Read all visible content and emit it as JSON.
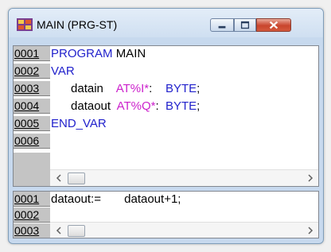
{
  "window": {
    "title": "MAIN (PRG-ST)"
  },
  "declarations": {
    "lines": [
      {
        "num": "0001",
        "tokens": [
          {
            "t": "PROGRAM ",
            "c": "kw"
          },
          {
            "t": "MAIN",
            "c": "tx"
          }
        ]
      },
      {
        "num": "0002",
        "tokens": [
          {
            "t": "VAR",
            "c": "kw"
          }
        ]
      },
      {
        "num": "0003",
        "tokens": [
          {
            "t": "      datain    ",
            "c": "tx"
          },
          {
            "t": "AT%I*",
            "c": "ad"
          },
          {
            "t": ":    ",
            "c": "tx"
          },
          {
            "t": "BYTE",
            "c": "kw"
          },
          {
            "t": ";",
            "c": "tx"
          }
        ]
      },
      {
        "num": "0004",
        "tokens": [
          {
            "t": "      dataout  ",
            "c": "tx"
          },
          {
            "t": "AT%Q*",
            "c": "ad"
          },
          {
            "t": ":  ",
            "c": "tx"
          },
          {
            "t": "BYTE",
            "c": "kw"
          },
          {
            "t": ";",
            "c": "tx"
          }
        ]
      },
      {
        "num": "0005",
        "tokens": [
          {
            "t": "END_VAR",
            "c": "kw"
          }
        ]
      },
      {
        "num": "0006",
        "tokens": []
      }
    ]
  },
  "body": {
    "lines": [
      {
        "num": "0001",
        "tokens": [
          {
            "t": "dataout:=       dataout+1;",
            "c": "tx"
          }
        ]
      },
      {
        "num": "0002",
        "tokens": []
      },
      {
        "num": "0003",
        "tokens": []
      }
    ]
  },
  "icons": {
    "app": "program-icon",
    "minimize": "minimize-icon",
    "maximize": "maximize-icon",
    "close": "close-icon",
    "left": "arrow-left-icon",
    "right": "arrow-right-icon"
  }
}
